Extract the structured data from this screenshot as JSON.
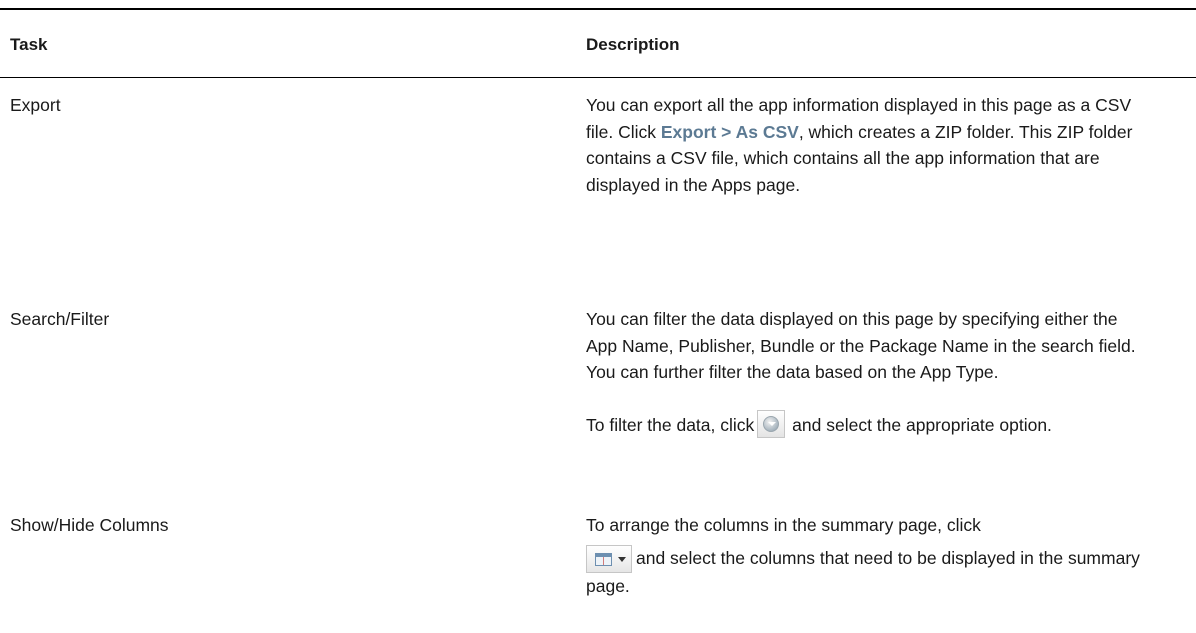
{
  "table": {
    "headers": {
      "task": "Task",
      "description": "Description"
    },
    "rows": [
      {
        "task": "Export",
        "desc": {
          "t1": "You can export all the app information displayed in this page as a CSV file. Click ",
          "ref": "Export > As CSV",
          "t2": ", which creates a ZIP folder. This ZIP folder contains a CSV file, which contains all the app information that are displayed in the Apps page."
        }
      },
      {
        "task": "Search/Filter",
        "desc": {
          "p1": "You can filter the data displayed on this page by specifying either the App Name, Publisher, Bundle or the Package Name in the search field. You can further filter the data based on the App Type.",
          "p2_before": "To filter the data, click",
          "p2_icon": "filter-icon",
          "p2_after": "and select the appropriate option."
        }
      },
      {
        "task": "Show/Hide Columns",
        "desc": {
          "before": "To arrange the columns in the summary page, click",
          "icon": "columns-icon",
          "after": "and select the columns that need to be displayed in the summary page."
        }
      }
    ]
  },
  "colors": {
    "ui_reference": "#5c7a93",
    "rule": "#000000"
  }
}
